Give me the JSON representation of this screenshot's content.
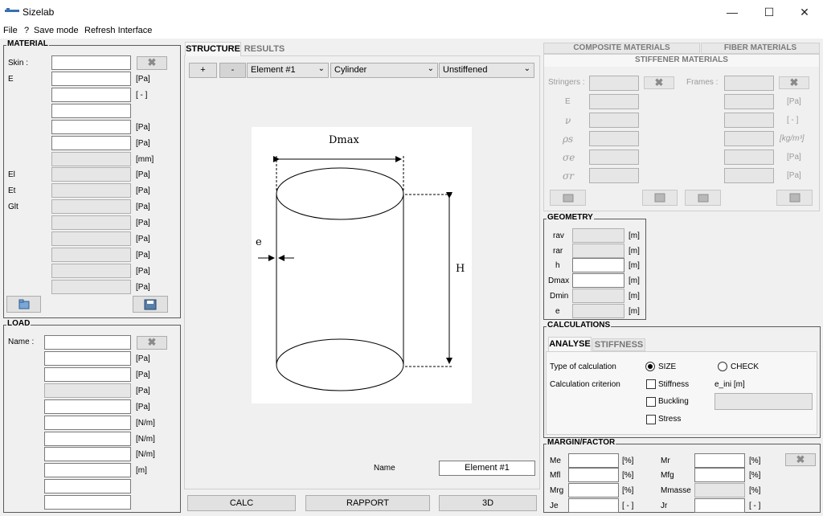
{
  "window": {
    "title": "Sizelab",
    "minimize": "—",
    "maximize": "☐",
    "close": "✕"
  },
  "menu": {
    "file": "File",
    "help": "?",
    "save_mode": "Save mode",
    "refresh": "Refresh Interface"
  },
  "material": {
    "title": "MATERIAL",
    "skin_label": "Skin :",
    "labels": [
      "E",
      "El",
      "Et",
      "Glt"
    ],
    "units": [
      "[Pa]",
      "[ - ]",
      "[Pa]",
      "[Pa]",
      "[mm]",
      "[Pa]",
      "[Pa]",
      "[Pa]",
      "[Pa]",
      "[Pa]",
      "[Pa]",
      "[Pa]",
      "[Pa]"
    ]
  },
  "load": {
    "title": "LOAD",
    "name_label": "Name :",
    "units": [
      "[Pa]",
      "[Pa]",
      "[Pa]",
      "[Pa]",
      "[N/m]",
      "[N/m]",
      "[N/m]",
      "[m]"
    ]
  },
  "center": {
    "tabs": [
      "STRUCTURE",
      "RESULTS"
    ],
    "plus": "+",
    "minus": "-",
    "element_select": "Element #1",
    "shape_select": "Cylinder",
    "stiffening_select": "Unstiffened",
    "name_label": "Name",
    "name_value": "Element #1",
    "buttons": {
      "calc": "CALC",
      "rapport": "RAPPORT",
      "view3d": "3D"
    },
    "drawing": {
      "dmax": "Dmax",
      "e": "e",
      "h": "H"
    }
  },
  "materials_tabs": {
    "composite": "COMPOSITE MATERIALS",
    "fiber": "FIBER MATERIALS",
    "stiffener": "STIFFENER MATERIALS"
  },
  "stiffener": {
    "stringers": "Stringers :",
    "frames": "Frames :",
    "row_labels": [
      "E",
      "ν",
      "ρs",
      "σe",
      "σr"
    ],
    "units": [
      "[Pa]",
      "[ - ]",
      "[kg/m³]",
      "[Pa]",
      "[Pa]"
    ]
  },
  "geometry": {
    "title": "GEOMETRY",
    "labels": [
      "rav",
      "rar",
      "h",
      "Dmax",
      "Dmin",
      "e"
    ],
    "unit": "[m]"
  },
  "calculations": {
    "title": "CALCULATIONS",
    "tabs": [
      "ANALYSE",
      "STIFFNESS"
    ],
    "type_label": "Type of calculation",
    "size": "SIZE",
    "check": "CHECK",
    "criterion_label": "Calculation criterion",
    "stiffness": "Stiffness",
    "buckling": "Buckling",
    "stress": "Stress",
    "e_ini": "e_ini [m]"
  },
  "margin": {
    "title": "MARGIN/FACTOR",
    "left_labels": [
      "Me",
      "Mfl",
      "Mrg",
      "Je"
    ],
    "left_units": [
      "[%]",
      "[%]",
      "[%]",
      "[ - ]"
    ],
    "right_labels": [
      "Mr",
      "Mfg",
      "Mmasse",
      "Jr"
    ],
    "right_units": [
      "[%]",
      "[%]",
      "[%]",
      "[ - ]"
    ]
  }
}
